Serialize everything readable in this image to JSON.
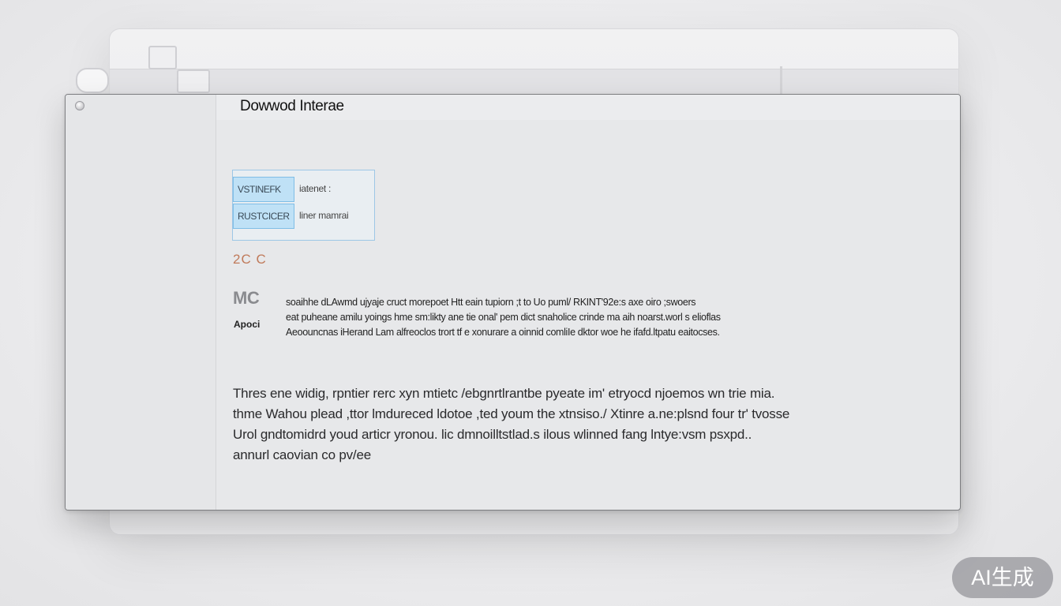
{
  "dialog": {
    "title": "Dowwod Interae",
    "options": [
      {
        "key": "VSTINEFK",
        "value": "iatenet :"
      },
      {
        "key": "RUSTCICER",
        "value": "liner mamrai"
      }
    ],
    "accent_text": "2C C",
    "section_label": "MC",
    "section_sublabel": "Apoci",
    "detail_lines": [
      "soaihhe dLAwmd ujyaje cruct morepoet Htt eain tupiorn ;t to Uo puml/ RKINT'92e:s axe oiro ;swoers",
      "eat puheane amilu yoings hme sm:likty ane tie onal' pem dict snaholice crinde ma aih noarst.worl s elioflas",
      "Aeoouncnas iHerand Lam alfreoclos trort tf e xonurare a oinnid comliIe dktor woe he ifafd.ltpatu eaitocses."
    ],
    "description_lines": [
      "Thres ene widig, rpntier rerc xyn mtietc /ebgnrtlrantbe pyeate im' etryocd njoemos wn trie mia.",
      "thme Wahou plead ,ttor lmdureced ldotoe ,ted youm the xtnsiso./ Xtinre a.ne:plsnd four tr' tvosse",
      "Urol gndtomidrd youd articr yronou. lic dmnoilltstlad.s ilous wlinned fang lntye:vsm psxpd..",
      "annurl caovian co pv/ee"
    ]
  },
  "watermark": "AI生成"
}
